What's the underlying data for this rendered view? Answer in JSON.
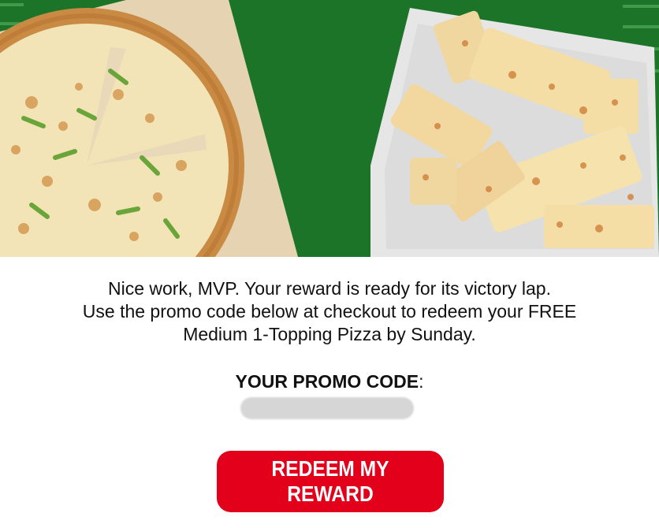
{
  "message": {
    "line1": "Nice work, MVP. Your reward is ready for its victory lap.",
    "line2": "Use the promo code below at checkout to redeem your FREE",
    "line3": "Medium 1-Topping Pizza by Sunday."
  },
  "promo": {
    "label": "YOUR PROMO CODE",
    "suffix": ":"
  },
  "cta": {
    "label": "REDEEM MY REWARD"
  },
  "colors": {
    "field_green": "#1f7a2c",
    "cta_red": "#e2001a"
  }
}
